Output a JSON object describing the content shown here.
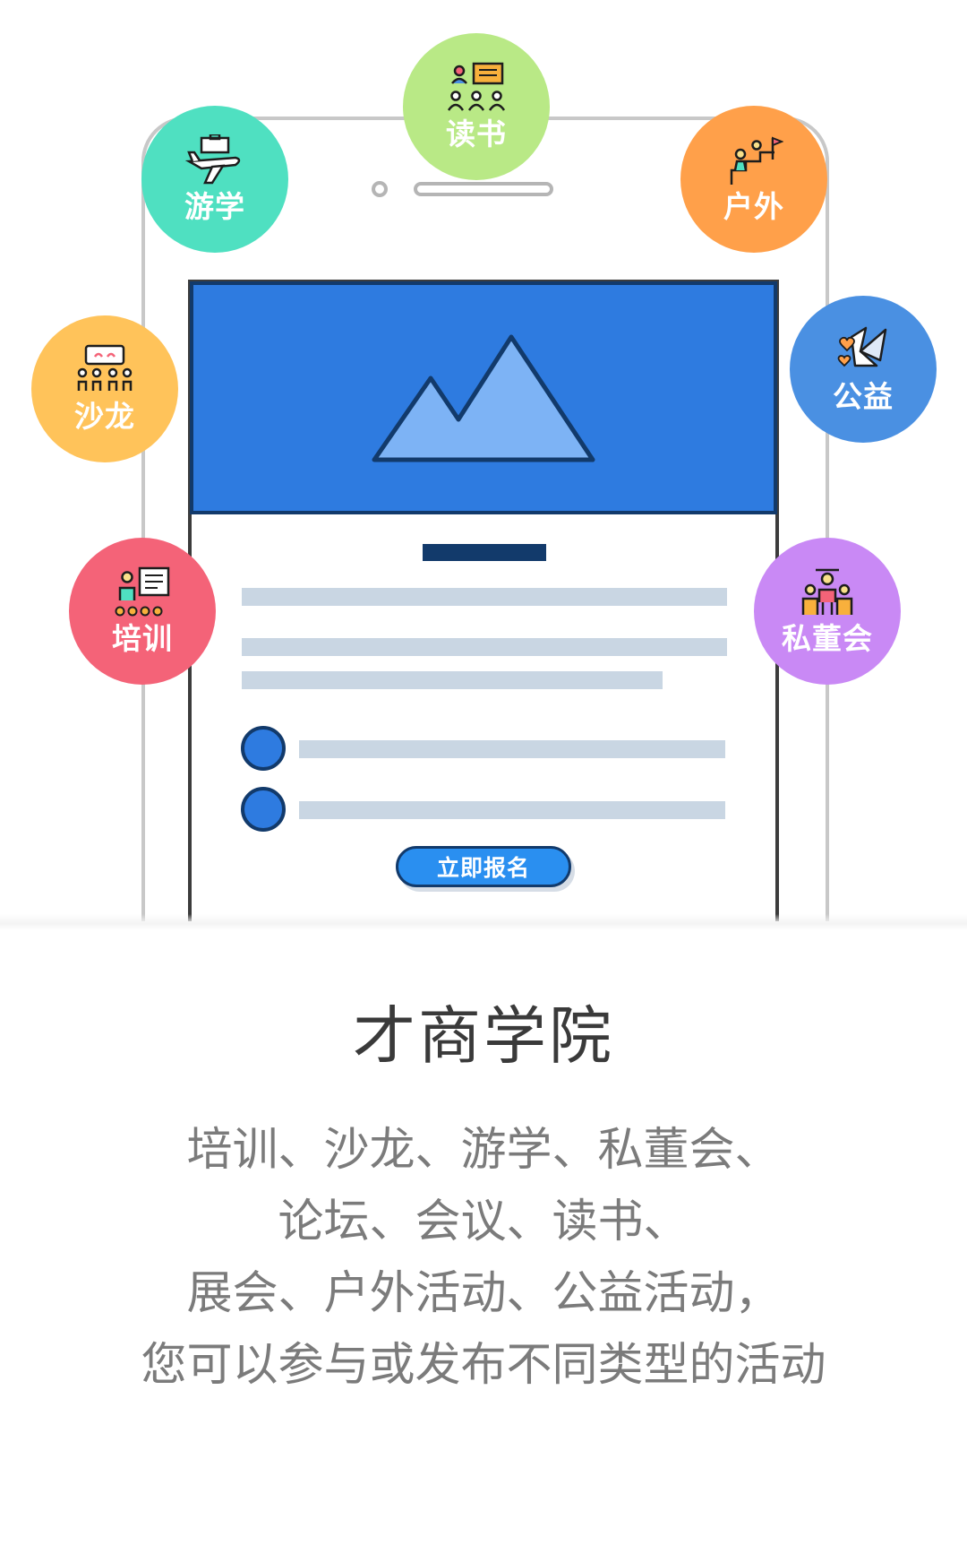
{
  "bubbles": {
    "reading": {
      "label": "读书",
      "color": "#b9e986",
      "icon": "audience-presentation-icon"
    },
    "travel": {
      "label": "游学",
      "color": "#4fe0c1",
      "icon": "airplane-briefcase-icon"
    },
    "outdoor": {
      "label": "户外",
      "color": "#ffa04a",
      "icon": "climbing-flag-icon"
    },
    "charity": {
      "label": "公益",
      "color": "#4a90e2",
      "icon": "origami-crane-icon"
    },
    "salon": {
      "label": "沙龙",
      "color": "#ffc35a",
      "icon": "group-discussion-icon"
    },
    "training": {
      "label": "培训",
      "color": "#f46378",
      "icon": "teacher-board-icon"
    },
    "director": {
      "label": "私董会",
      "color": "#c989f5",
      "icon": "leaders-group-icon"
    }
  },
  "card": {
    "signup_label": "立即报名",
    "banner_color": "#2e7be0",
    "accent_color": "#123a6b"
  },
  "intro": {
    "title": "才商学院",
    "lines": [
      "培训、沙龙、游学、私董会、",
      "论坛、会议、读书、",
      "展会、户外活动、公益活动，",
      "您可以参与或发布不同类型的活动"
    ]
  }
}
